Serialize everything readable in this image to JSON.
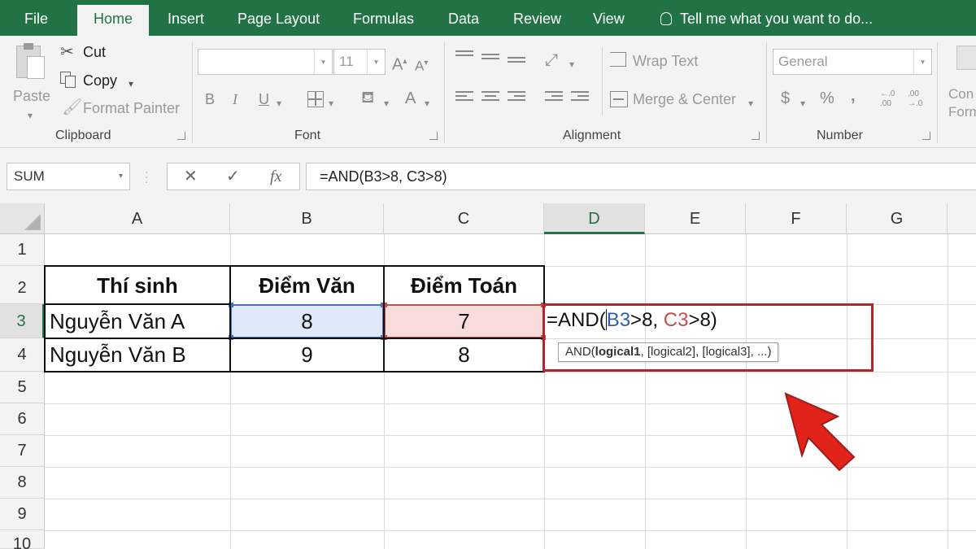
{
  "ribbon_tabs": [
    "File",
    "Home",
    "Insert",
    "Page Layout",
    "Formulas",
    "Data",
    "Review",
    "View"
  ],
  "tell_me": "Tell me what you want to do...",
  "clipboard": {
    "paste": "Paste",
    "cut": "Cut",
    "copy": "Copy",
    "format_painter": "Format Painter",
    "label": "Clipboard"
  },
  "font": {
    "name_value": "",
    "size_value": "11",
    "bold": "B",
    "italic": "I",
    "underline": "U",
    "font_color": "A",
    "grow": "A",
    "shrink": "A",
    "label": "Font"
  },
  "alignment": {
    "wrap_text": "Wrap Text",
    "merge_center": "Merge & Center",
    "label": "Alignment"
  },
  "number": {
    "format_value": "General",
    "currency": "$",
    "percent": "%",
    "comma": ",",
    "inc_decimal": "←.0 .00",
    "dec_decimal": ".00 →.0",
    "label": "Number"
  },
  "cond_format_partial": [
    "Con",
    "Form"
  ],
  "formula_bar": {
    "name_box": "SUM",
    "cancel": "✕",
    "enter": "✓",
    "fx": "fx",
    "formula": "=AND(B3>8, C3>8)"
  },
  "columns": [
    "A",
    "B",
    "C",
    "D",
    "E",
    "F",
    "G"
  ],
  "rows": [
    "1",
    "2",
    "3",
    "4",
    "5",
    "6",
    "7",
    "8",
    "9",
    "10"
  ],
  "table": {
    "headers": [
      "Thí sinh",
      "Điểm Văn",
      "Điểm Toán"
    ],
    "rows": [
      [
        "Nguyễn Văn A",
        "8",
        "7"
      ],
      [
        "Nguyễn Văn B",
        "9",
        "8"
      ]
    ]
  },
  "editing": {
    "prefix": "=AND(",
    "ref1": "B3",
    "mid": ">8, ",
    "ref2": "C3",
    "suffix": ">8)",
    "tooltip_fn": "AND(",
    "tooltip_bold": "logical1",
    "tooltip_rest": ", [logical2], [logical3], ...)"
  },
  "colors": {
    "excel_green": "#217346",
    "highlight_blue": "#4472c4",
    "highlight_red": "#c0504d",
    "annotation_red": "#b3242b"
  }
}
